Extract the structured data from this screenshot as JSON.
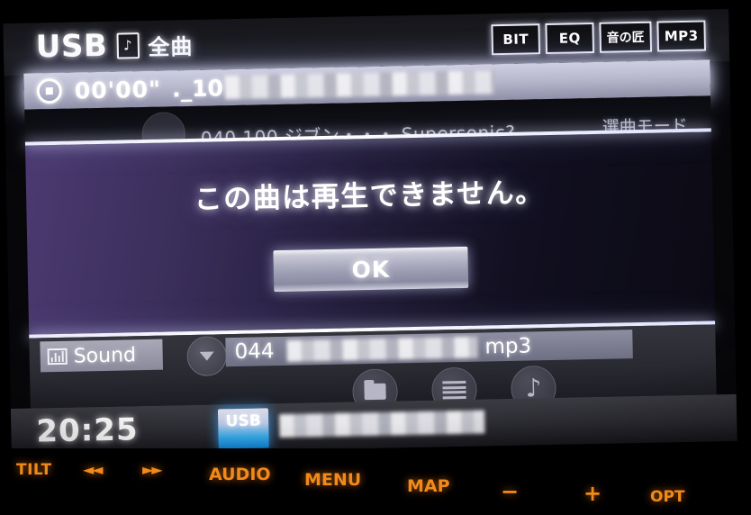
{
  "header": {
    "source_label": "USB",
    "note_icon": "music-note-icon",
    "mode_label": "全曲",
    "badges": [
      {
        "id": "bit",
        "label": "BIT"
      },
      {
        "id": "eq",
        "label": "EQ"
      },
      {
        "id": "oto",
        "label": "音の匠"
      },
      {
        "id": "mp3",
        "label": "MP3"
      }
    ]
  },
  "track_bar": {
    "status_icon": "stop-icon",
    "elapsed_time": "00'00\"",
    "filename_prefix": "._10",
    "filename_redacted": true
  },
  "list_row": {
    "track_numbers": "040   100",
    "partial_text": "040   100 ジブン・・・ Supersonic?",
    "right_label": "選曲モード"
  },
  "dialog": {
    "message": "この曲は再生できません。",
    "ok_label": "OK"
  },
  "lower_controls": {
    "sound_button": "Sound",
    "sound_icon": "equalizer-icon",
    "chevron_icon": "chevron-down-icon",
    "now_playing": {
      "track_number": "044",
      "title_redacted": true,
      "extension": "mp3"
    },
    "circle_buttons": [
      {
        "id": "folder",
        "icon": "folder-icon"
      },
      {
        "id": "list",
        "icon": "list-icon"
      },
      {
        "id": "track",
        "icon": "music-note-icon"
      }
    ]
  },
  "status_bar": {
    "clock": "20:25",
    "source_tag": "USB",
    "source_name_redacted": true
  },
  "hard_keys": [
    {
      "id": "tilt",
      "label": "TILT"
    },
    {
      "id": "prev",
      "label": "◄◄"
    },
    {
      "id": "next",
      "label": "►►"
    },
    {
      "id": "audio",
      "label": "AUDIO"
    },
    {
      "id": "menu",
      "label": "MENU"
    },
    {
      "id": "map",
      "label": "MAP"
    },
    {
      "id": "minus",
      "label": "−"
    },
    {
      "id": "plus",
      "label": "+"
    },
    {
      "id": "opt",
      "label": "OPT"
    }
  ],
  "colors": {
    "key_amber": "#f08a1a",
    "dialog_purple": "#4b3a70",
    "usb_blue": "#34a9e8"
  }
}
